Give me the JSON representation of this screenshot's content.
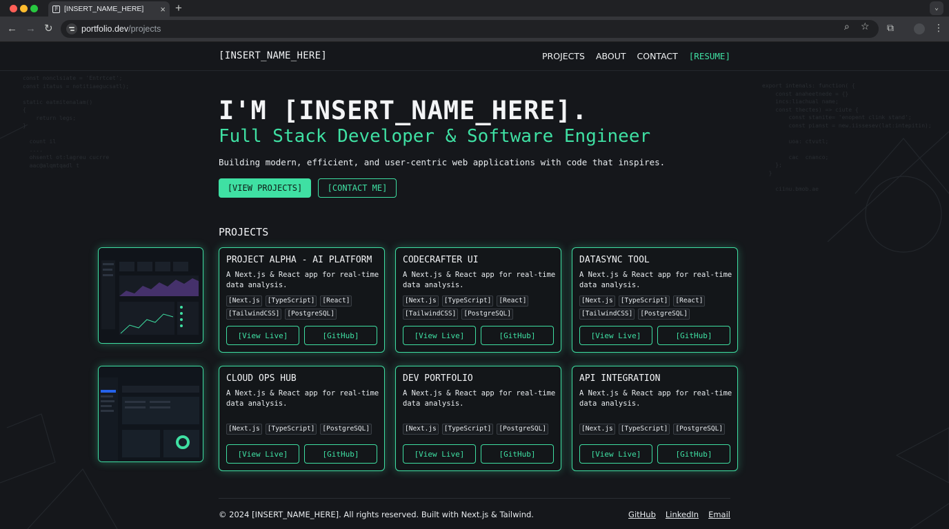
{
  "browser": {
    "tab_title": "[INSERT_NAME_HERE]",
    "tab_favicon": "[I",
    "new_tab": "+",
    "url_host": "portfolio.dev",
    "url_path": "/projects"
  },
  "nav": {
    "brand": "[INSERT_NAME_HERE]",
    "links": [
      "PROJECTS",
      "ABOUT",
      "CONTACT"
    ],
    "resume": "[RESUME]"
  },
  "hero": {
    "title": "I'M [INSERT_NAME_HERE].",
    "subtitle": "Full Stack Developer & Software Engineer",
    "description": "Building modern, efficient, and user-centric web applications with code that inspires.",
    "primary_button": "[VIEW PROJECTS]",
    "secondary_button": "[CONTACT ME]"
  },
  "projects": {
    "heading": "PROJECTS",
    "items": [
      {
        "title": "PROJECT ALPHA - AI PLATFORM",
        "description": "A Next.js & React app for real-time data analysis.",
        "tags": [
          "[Next.js",
          "[TypeScript]",
          "[React]",
          "[TailwindCSS]",
          "[PostgreSQL]"
        ],
        "live": "[View Live]",
        "github": "[GitHub]"
      },
      {
        "title": "CODECRAFTER UI",
        "description": "A Next.js & React app for real-time data analysis.",
        "tags": [
          "[Next.js",
          "[TypeScript]",
          "[React]",
          "[TailwindCSS]",
          "[PostgreSQL]"
        ],
        "live": "[View Live]",
        "github": "[GitHub]"
      },
      {
        "title": "DATASYNC TOOL",
        "description": "A Next.js & React app for real-time data analysis.",
        "tags": [
          "[Next.js",
          "[TypeScript]",
          "[React]",
          "[TailwindCSS]",
          "[PostgreSQL]"
        ],
        "live": "[View Live]",
        "github": "[GitHub]"
      },
      {
        "title": "CLOUD OPS HUB",
        "description": "A Next.js & React app for real-time data analysis.",
        "tags": [
          "[Next.js",
          "[TypeScript]",
          "[PostgreSQL]"
        ],
        "live": "[View Live]",
        "github": "[GitHub]"
      },
      {
        "title": "DEV PORTFOLIO",
        "description": "A Next.js & React app for real-time data analysis.",
        "tags": [
          "[Next.js",
          "[TypeScript]",
          "[PostgreSQL]"
        ],
        "live": "[View Live]",
        "github": "[GitHub]"
      },
      {
        "title": "API INTEGRATION",
        "description": "A Next.js & React app for real-time data analysis.",
        "tags": [
          "[Next.js",
          "[TypeScript]",
          "[PostgreSQL]"
        ],
        "live": "[View Live]",
        "github": "[GitHub]"
      }
    ]
  },
  "footer": {
    "copyright": "© 2024 [INSERT_NAME_HERE]. All rights reserved. Built with Next.js & Tailwind.",
    "links": [
      "GitHub",
      "LinkedIn",
      "Email"
    ]
  },
  "colors": {
    "accent": "#3fe0a3",
    "background": "#15171b",
    "card": "#131619"
  },
  "icons": {
    "nav_back": "back-arrow-icon",
    "nav_forward": "forward-arrow-icon",
    "reload": "reload-icon",
    "site_info": "site-info-icon",
    "zoom": "zoom-icon",
    "bookmark": "star-icon",
    "extensions": "puzzle-icon",
    "menu": "kebab-menu-icon"
  }
}
